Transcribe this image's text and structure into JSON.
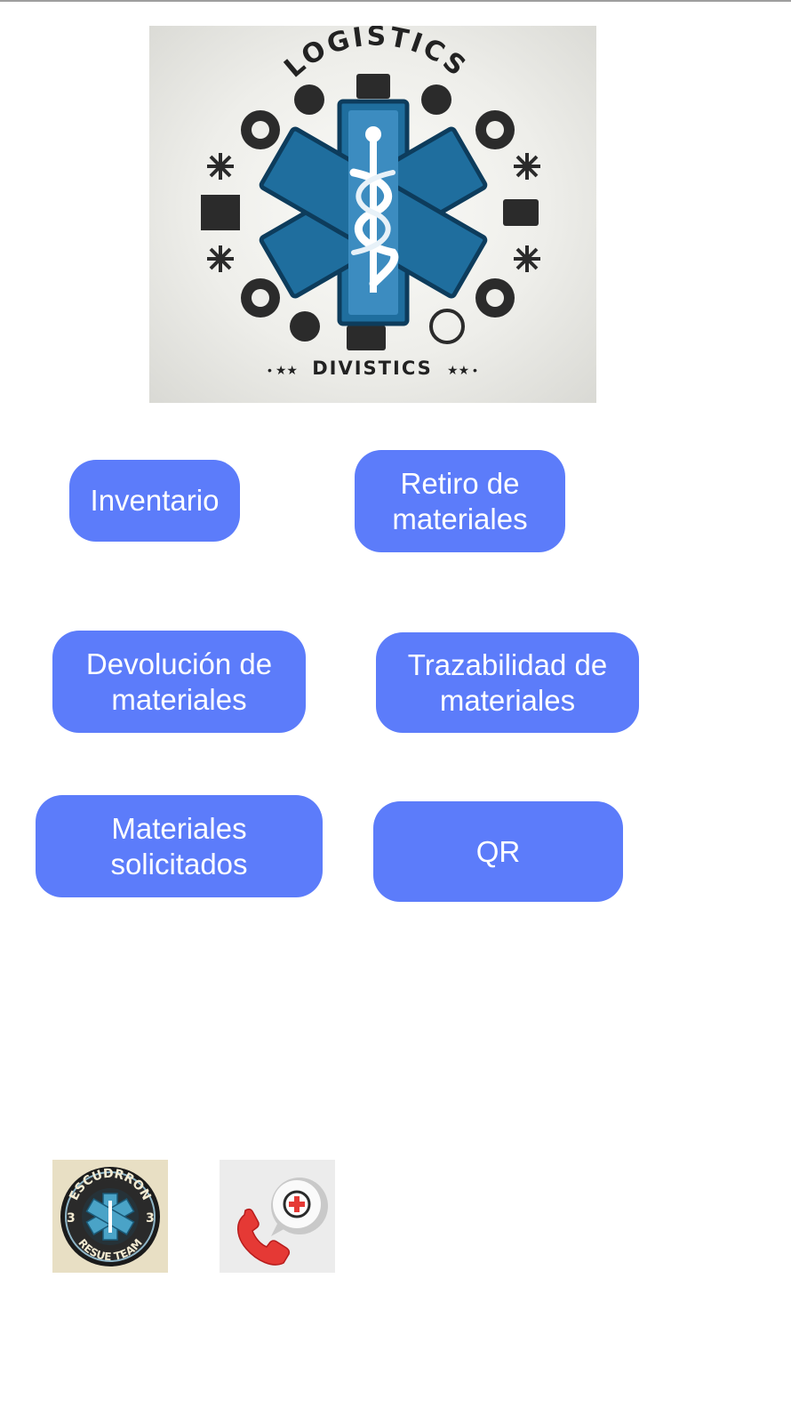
{
  "logo": {
    "text_top": "LOGISTICS",
    "text_bottom": "DIVISTICS",
    "icon": "star-of-life-caduceus-icon"
  },
  "menu": {
    "inventario": "Inventario",
    "retiro": "Retiro de\nmateriales",
    "devolucion": "Devolución de\nmateriales",
    "trazabilidad": "Trazabilidad de\nmateriales",
    "solicitados": "Materiales\nsolicitados",
    "qr": "QR"
  },
  "footer": {
    "badge_text_top": "ESCUDRRON",
    "badge_text_bottom": "RESUE TEAM",
    "badge_number": "3",
    "phone_icon": "emergency-phone-icon"
  },
  "colors": {
    "button_bg": "#5c7cfa",
    "button_text": "#ffffff",
    "star_blue": "#1f6e9e",
    "dark": "#2b2b2b",
    "phone_red": "#e53935"
  }
}
